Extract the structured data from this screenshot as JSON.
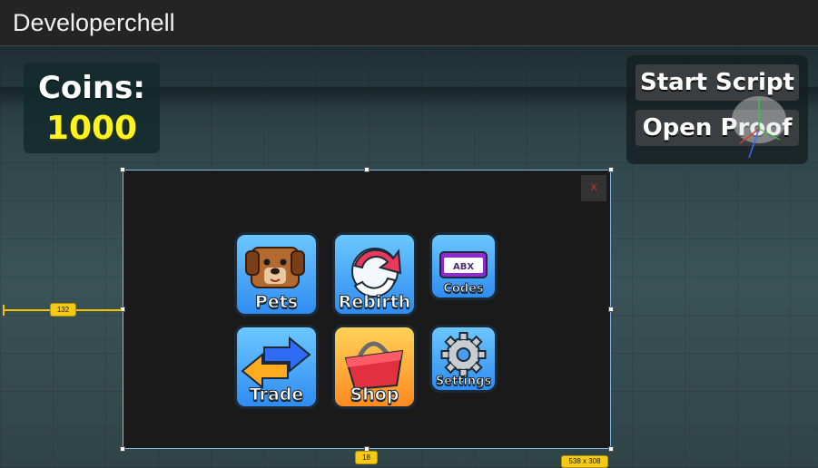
{
  "window": {
    "title": "Developerchell"
  },
  "hud": {
    "coins_label": "Coins:",
    "coins_value": "1000",
    "coins_value_color": "#fff41e"
  },
  "script_panel": {
    "start_label": "Start Script",
    "open_label": "Open Proof"
  },
  "menu": {
    "close_label": "X",
    "tiles": [
      {
        "label": "Pets",
        "icon": "dog-icon",
        "style": "blue"
      },
      {
        "label": "Rebirth",
        "icon": "rebirth-arrows-icon",
        "style": "blue"
      },
      {
        "label": "Codes",
        "icon": "code-window-icon",
        "icon_text": "ABX",
        "style": "blue"
      },
      {
        "label": "Trade",
        "icon": "trade-arrows-icon",
        "style": "blue"
      },
      {
        "label": "Shop",
        "icon": "shopping-basket-icon",
        "style": "orange"
      },
      {
        "label": "Settings",
        "icon": "gear-icon",
        "style": "blue"
      }
    ]
  },
  "editor_overlay": {
    "left_offset": "132",
    "bottom_offset": "18",
    "size": "538 x 308",
    "guide_color": "#f2c400",
    "selection_color": "#7fb9e6"
  }
}
